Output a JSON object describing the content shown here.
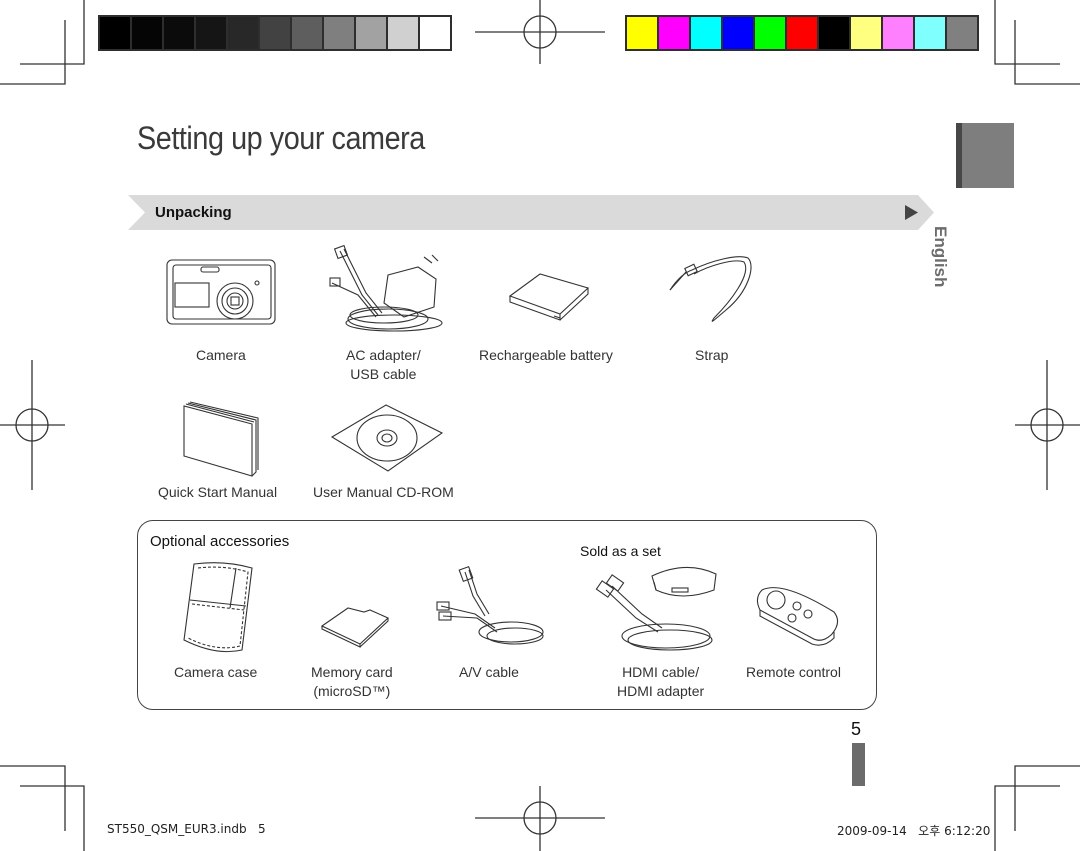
{
  "color_bars": {
    "grayscale": [
      "#000000",
      "#050505",
      "#0b0b0b",
      "#151515",
      "#282828",
      "#424242",
      "#5e5e5e",
      "#7f7f7f",
      "#a2a2a2",
      "#d0d0d0",
      "#ffffff"
    ],
    "color": [
      "#ffff00",
      "#ff00ff",
      "#00ffff",
      "#0000ff",
      "#00ff00",
      "#ff0000",
      "#000000",
      "#ffff80",
      "#ff80ff",
      "#80ffff",
      "#808080"
    ]
  },
  "page": {
    "title": "Setting up your camera",
    "language_tab": "English",
    "page_number": "5"
  },
  "unpacking": {
    "heading": "Unpacking",
    "items": [
      {
        "label": "Camera",
        "sub": ""
      },
      {
        "label": "AC adapter/",
        "sub": "USB cable"
      },
      {
        "label": "Rechargeable battery",
        "sub": ""
      },
      {
        "label": "Strap",
        "sub": ""
      },
      {
        "label": "Quick Start Manual",
        "sub": ""
      },
      {
        "label": "User Manual CD-ROM",
        "sub": ""
      }
    ]
  },
  "optional": {
    "heading": "Optional accessories",
    "set_note": "Sold as a set",
    "items": [
      {
        "label": "Camera case",
        "sub": ""
      },
      {
        "label": "Memory card",
        "sub": "(microSD™)"
      },
      {
        "label": "A/V cable",
        "sub": ""
      },
      {
        "label": "HDMI cable/",
        "sub": "HDMI adapter"
      },
      {
        "label": "Remote control",
        "sub": ""
      }
    ]
  },
  "footer": {
    "file": "ST550_QSM_EUR3.indb   5",
    "timestamp": "2009-09-14   오후 6:12:20"
  }
}
